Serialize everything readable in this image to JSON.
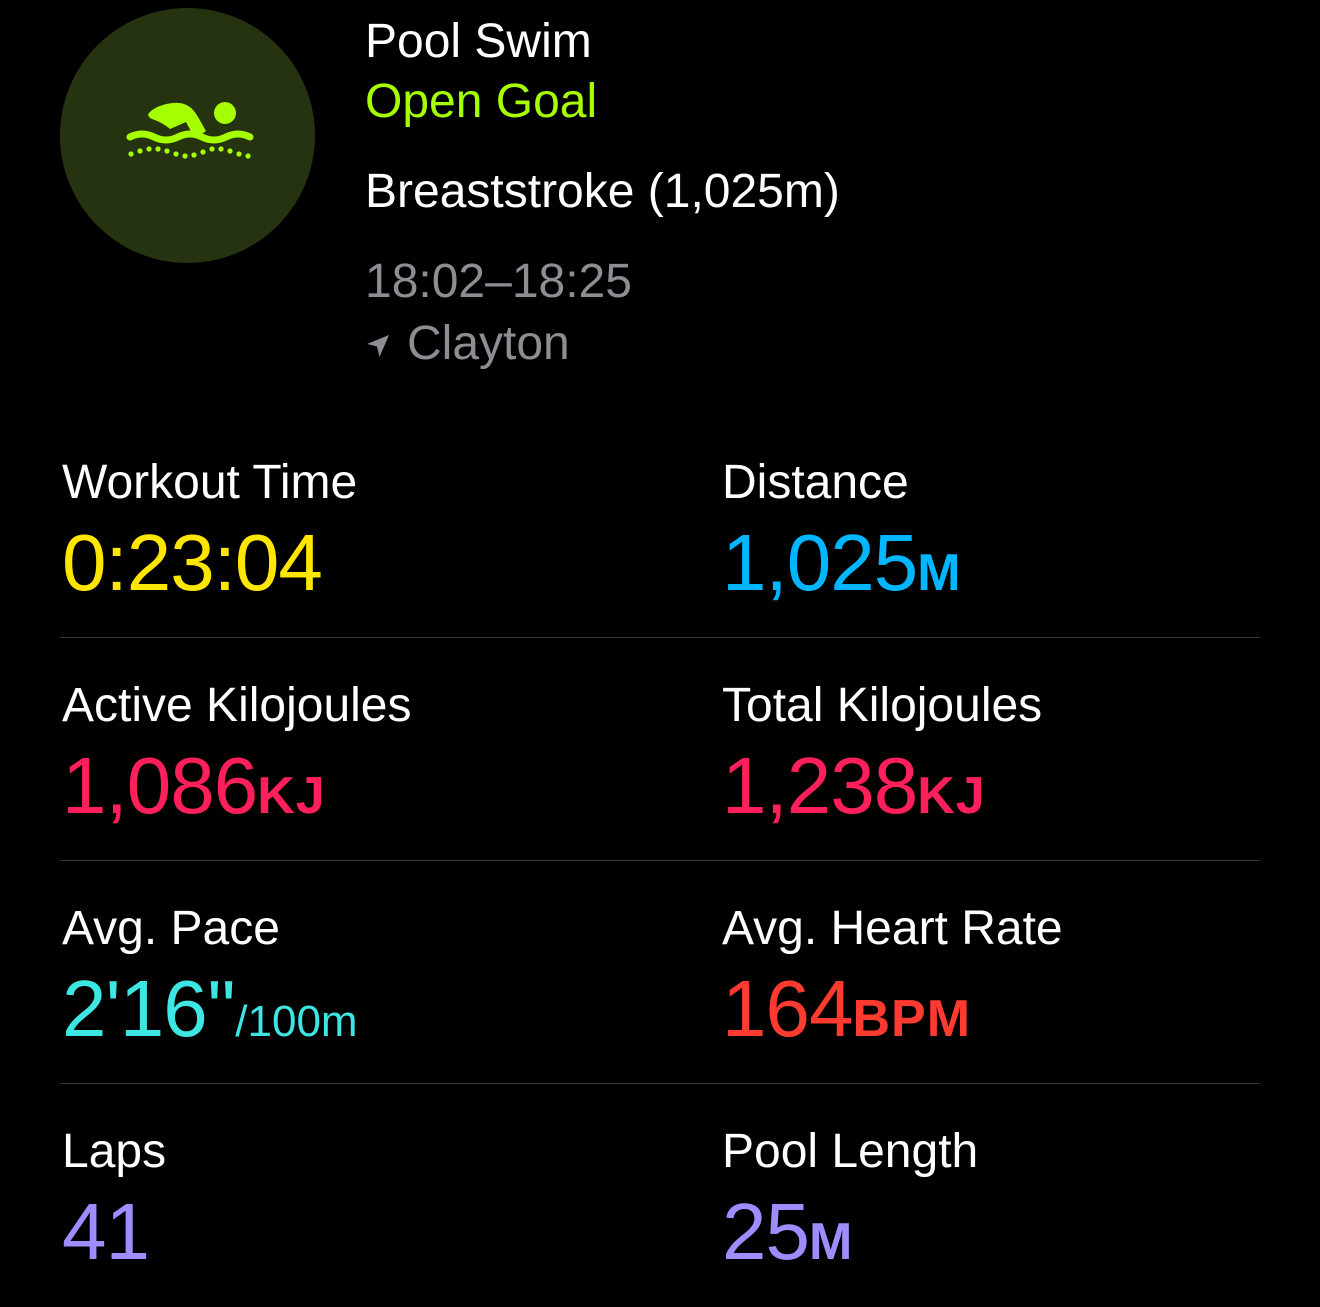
{
  "colors": {
    "background": "#000000",
    "badge_background": "#263311",
    "accent_green": "#a6ff00",
    "secondary_text": "#8d8d93",
    "divider": "#38383a",
    "time_yellow": "#ffe600",
    "distance_blue": "#00b7ff",
    "energy_pink": "#ff1f5a",
    "pace_cyan": "#3ee6e3",
    "heart_red": "#ff3a2f",
    "laps_purple": "#a18cff"
  },
  "header": {
    "icon": "pool-swim-icon",
    "title": "Pool Swim",
    "goal": "Open Goal",
    "stroke_summary": "Breaststroke (1,025m)",
    "time_range": "18:02–18:25",
    "location_icon": "location-arrow-icon",
    "location": "Clayton"
  },
  "metrics": {
    "workout_time": {
      "label": "Workout Time",
      "value": "0:23:04",
      "unit": ""
    },
    "distance": {
      "label": "Distance",
      "value": "1,025",
      "unit": "M"
    },
    "active_energy": {
      "label": "Active Kilojoules",
      "value": "1,086",
      "unit": "KJ"
    },
    "total_energy": {
      "label": "Total Kilojoules",
      "value": "1,238",
      "unit": "KJ"
    },
    "avg_pace": {
      "label": "Avg. Pace",
      "value": "2'16''",
      "unit": "/100m"
    },
    "avg_heart_rate": {
      "label": "Avg. Heart Rate",
      "value": "164",
      "unit": "BPM"
    },
    "laps": {
      "label": "Laps",
      "value": "41",
      "unit": ""
    },
    "pool_length": {
      "label": "Pool Length",
      "value": "25",
      "unit": "M"
    }
  }
}
